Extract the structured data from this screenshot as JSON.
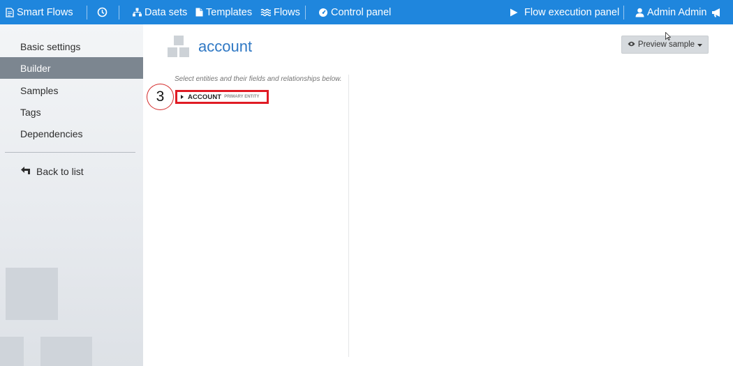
{
  "nav": {
    "brand": "Smart Flows",
    "datasets": "Data sets",
    "templates": "Templates",
    "flows": "Flows",
    "control_panel": "Control panel",
    "flow_execution": "Flow execution panel",
    "user": "Admin Admin",
    "icons": [
      "document-icon",
      "clock-icon",
      "sitemap-icon",
      "file-icon",
      "waves-icon",
      "gauge-icon",
      "play-icon",
      "user-icon",
      "megaphone-icon"
    ]
  },
  "sidebar": {
    "items": [
      {
        "label": "Basic settings",
        "active": false
      },
      {
        "label": "Builder",
        "active": true
      },
      {
        "label": "Samples",
        "active": false
      },
      {
        "label": "Tags",
        "active": false
      },
      {
        "label": "Dependencies",
        "active": false
      }
    ],
    "back": "Back to list"
  },
  "main": {
    "title": "account",
    "preview_button": "Preview sample",
    "hint": "Select entities and their fields and relationships below.",
    "entity": {
      "name": "ACCOUNT",
      "tag": "PRIMARY ENTITY"
    },
    "step_marker": "3"
  },
  "colors": {
    "nav_bg": "#1f86dd",
    "active_item_bg": "#7c8690",
    "title": "#2f78c4",
    "highlight": "#e01b24"
  }
}
